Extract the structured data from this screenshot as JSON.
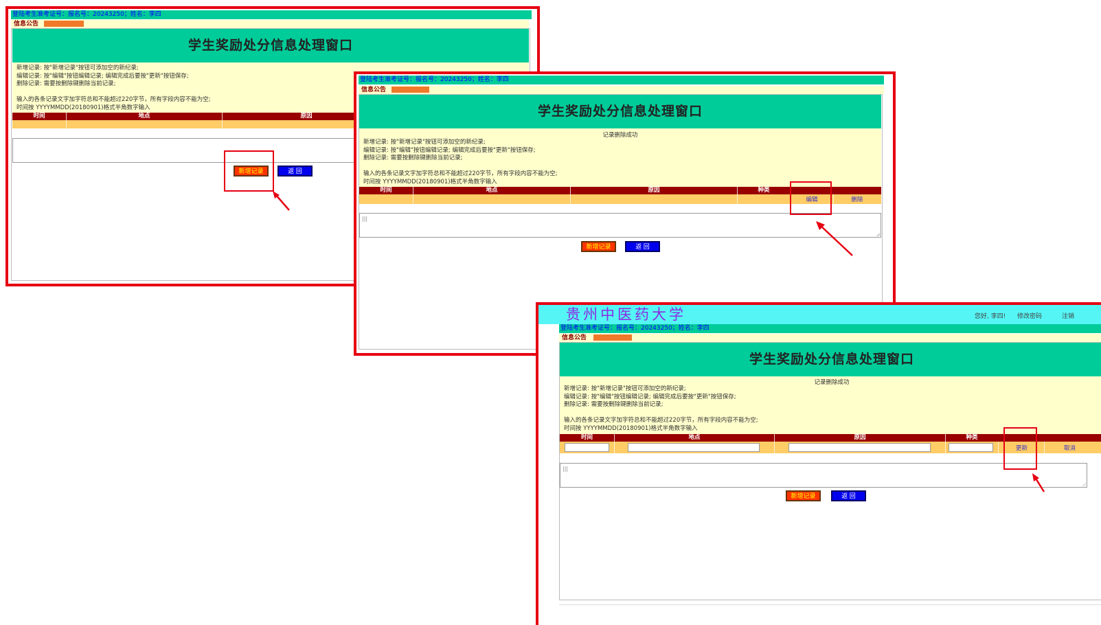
{
  "login_bar": "登陆考生准考证号：报名号：20243250；姓名：李四",
  "notice_label": "信息公告",
  "window_title": "学生奖励处分信息处理窗口",
  "status_message": "记录删除成功",
  "instructions": [
    "新增记录: 按\"新增记录\"按钮可添加空的新纪录;",
    "编辑记录: 按\"编辑\"按钮编辑记录; 编辑完成后要按\"更新\"按钮保存;",
    "删除记录: 需要按删除键删除当前记录;",
    "输入的各条记录文字加字符总和不能超过220字节，所有字段内容不能为空;",
    "时间按 YYYYMMDD(20180901)格式半角数字输入"
  ],
  "columns": {
    "time": "时间",
    "place": "地点",
    "reason": "原因",
    "type": "种类"
  },
  "row_actions": {
    "edit": "编辑",
    "delete": "删除",
    "update": "更新",
    "cancel": "取消"
  },
  "buttons": {
    "add": "新增记录",
    "back": "返 回"
  },
  "header": {
    "university": "贵州中医药大学",
    "greeting": "您好, 李四!",
    "change_password": "修改密码",
    "logout": "注销"
  },
  "colors": {
    "highlight": "#e60012",
    "banner": "#00cc99",
    "panel": "#ffffcc",
    "table_header": "#990000",
    "table_row": "#ffcc66"
  }
}
